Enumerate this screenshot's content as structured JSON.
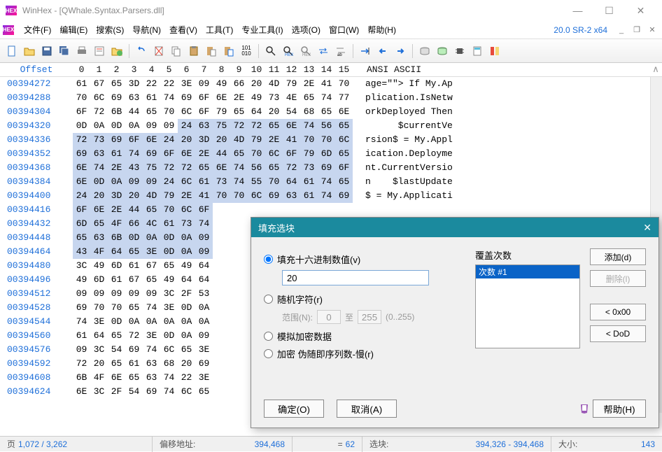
{
  "window": {
    "title": "WinHex - [QWhale.Syntax.Parsers.dll]"
  },
  "menus": [
    "文件(F)",
    "编辑(E)",
    "搜索(S)",
    "导航(N)",
    "查看(V)",
    "工具(T)",
    "专业工具(I)",
    "选项(O)",
    "窗口(W)",
    "帮助(H)"
  ],
  "version": "20.0 SR-2 x64",
  "hex": {
    "offset_label": "Offset",
    "cols": [
      "0",
      "1",
      "2",
      "3",
      "4",
      "5",
      "6",
      "7",
      "8",
      "9",
      "10",
      "11",
      "12",
      "13",
      "14",
      "15"
    ],
    "ansi_label": "ANSI ASCII",
    "rows": [
      {
        "off": "00394272",
        "b": [
          "61",
          "67",
          "65",
          "3D",
          "22",
          "22",
          "3E",
          "09",
          "49",
          "66",
          "20",
          "4D",
          "79",
          "2E",
          "41",
          "70"
        ],
        "t": "age=\"\"> If My.Ap",
        "sel": []
      },
      {
        "off": "00394288",
        "b": [
          "70",
          "6C",
          "69",
          "63",
          "61",
          "74",
          "69",
          "6F",
          "6E",
          "2E",
          "49",
          "73",
          "4E",
          "65",
          "74",
          "77"
        ],
        "t": "plication.IsNetw",
        "sel": []
      },
      {
        "off": "00394304",
        "b": [
          "6F",
          "72",
          "6B",
          "44",
          "65",
          "70",
          "6C",
          "6F",
          "79",
          "65",
          "64",
          "20",
          "54",
          "68",
          "65",
          "6E"
        ],
        "t": "orkDeployed Then",
        "sel": []
      },
      {
        "off": "00394320",
        "b": [
          "0D",
          "0A",
          "0D",
          "0A",
          "09",
          "09",
          "24",
          "63",
          "75",
          "72",
          "72",
          "65",
          "6E",
          "74",
          "56",
          "65"
        ],
        "t": "      $currentVe",
        "sel": [
          6,
          7,
          8,
          9,
          10,
          11,
          12,
          13,
          14,
          15
        ]
      },
      {
        "off": "00394336",
        "b": [
          "72",
          "73",
          "69",
          "6F",
          "6E",
          "24",
          "20",
          "3D",
          "20",
          "4D",
          "79",
          "2E",
          "41",
          "70",
          "70",
          "6C"
        ],
        "t": "rsion$ = My.Appl",
        "sel": [
          0,
          1,
          2,
          3,
          4,
          5,
          6,
          7,
          8,
          9,
          10,
          11,
          12,
          13,
          14,
          15
        ]
      },
      {
        "off": "00394352",
        "b": [
          "69",
          "63",
          "61",
          "74",
          "69",
          "6F",
          "6E",
          "2E",
          "44",
          "65",
          "70",
          "6C",
          "6F",
          "79",
          "6D",
          "65"
        ],
        "t": "ication.Deployme",
        "sel": [
          0,
          1,
          2,
          3,
          4,
          5,
          6,
          7,
          8,
          9,
          10,
          11,
          12,
          13,
          14,
          15
        ]
      },
      {
        "off": "00394368",
        "b": [
          "6E",
          "74",
          "2E",
          "43",
          "75",
          "72",
          "72",
          "65",
          "6E",
          "74",
          "56",
          "65",
          "72",
          "73",
          "69",
          "6F"
        ],
        "t": "nt.CurrentVersio",
        "sel": [
          0,
          1,
          2,
          3,
          4,
          5,
          6,
          7,
          8,
          9,
          10,
          11,
          12,
          13,
          14,
          15
        ]
      },
      {
        "off": "00394384",
        "b": [
          "6E",
          "0D",
          "0A",
          "09",
          "09",
          "24",
          "6C",
          "61",
          "73",
          "74",
          "55",
          "70",
          "64",
          "61",
          "74",
          "65"
        ],
        "t": "n    $lastUpdate",
        "sel": [
          0,
          1,
          2,
          3,
          4,
          5,
          6,
          7,
          8,
          9,
          10,
          11,
          12,
          13,
          14,
          15
        ]
      },
      {
        "off": "00394400",
        "b": [
          "24",
          "20",
          "3D",
          "20",
          "4D",
          "79",
          "2E",
          "41",
          "70",
          "70",
          "6C",
          "69",
          "63",
          "61",
          "74",
          "69"
        ],
        "t": "$ = My.Applicati",
        "sel": [
          0,
          1,
          2,
          3,
          4,
          5,
          6,
          7,
          8,
          9,
          10,
          11,
          12,
          13,
          14,
          15
        ]
      },
      {
        "off": "00394416",
        "b": [
          "6F",
          "6E",
          "2E",
          "44",
          "65",
          "70",
          "6C",
          "6F",
          "",
          "",
          "",
          "",
          "",
          "",
          "",
          ""
        ],
        "t": "",
        "sel": [
          0,
          1,
          2,
          3,
          4,
          5,
          6,
          7
        ]
      },
      {
        "off": "00394432",
        "b": [
          "6D",
          "65",
          "4F",
          "66",
          "4C",
          "61",
          "73",
          "74",
          "",
          "",
          "",
          "",
          "",
          "",
          "",
          ""
        ],
        "t": "",
        "sel": [
          0,
          1,
          2,
          3,
          4,
          5,
          6,
          7
        ]
      },
      {
        "off": "00394448",
        "b": [
          "65",
          "63",
          "6B",
          "0D",
          "0A",
          "0D",
          "0A",
          "09",
          "",
          "",
          "",
          "",
          "",
          "",
          "",
          ""
        ],
        "t": "",
        "sel": [
          0,
          1,
          2,
          3,
          4,
          5,
          6,
          7
        ]
      },
      {
        "off": "00394464",
        "b": [
          "43",
          "4F",
          "64",
          "65",
          "3E",
          "0D",
          "0A",
          "09",
          "",
          "",
          "",
          "",
          "",
          "",
          "",
          ""
        ],
        "t": "",
        "sel": [
          0,
          1,
          2,
          3,
          4,
          5,
          6,
          7
        ]
      },
      {
        "off": "00394480",
        "b": [
          "3C",
          "49",
          "6D",
          "61",
          "67",
          "65",
          "49",
          "64",
          "",
          "",
          "",
          "",
          "",
          "",
          "",
          ""
        ],
        "t": "",
        "sel": []
      },
      {
        "off": "00394496",
        "b": [
          "49",
          "6D",
          "61",
          "67",
          "65",
          "49",
          "64",
          "64",
          "",
          "",
          "",
          "",
          "",
          "",
          "",
          ""
        ],
        "t": "",
        "sel": []
      },
      {
        "off": "00394512",
        "b": [
          "09",
          "09",
          "09",
          "09",
          "09",
          "3C",
          "2F",
          "53",
          "",
          "",
          "",
          "",
          "",
          "",
          "",
          ""
        ],
        "t": "",
        "sel": []
      },
      {
        "off": "00394528",
        "b": [
          "69",
          "70",
          "70",
          "65",
          "74",
          "3E",
          "0D",
          "0A",
          "",
          "",
          "",
          "",
          "",
          "",
          "",
          ""
        ],
        "t": "",
        "sel": []
      },
      {
        "off": "00394544",
        "b": [
          "74",
          "3E",
          "0D",
          "0A",
          "0A",
          "0A",
          "0A",
          "0A",
          "",
          "",
          "",
          "",
          "",
          "",
          "",
          ""
        ],
        "t": "",
        "sel": []
      },
      {
        "off": "00394560",
        "b": [
          "61",
          "64",
          "65",
          "72",
          "3E",
          "0D",
          "0A",
          "09",
          "",
          "",
          "",
          "",
          "",
          "",
          "",
          ""
        ],
        "t": "",
        "sel": []
      },
      {
        "off": "00394576",
        "b": [
          "09",
          "3C",
          "54",
          "69",
          "74",
          "6C",
          "65",
          "3E",
          "",
          "",
          "",
          "",
          "",
          "",
          "",
          ""
        ],
        "t": "",
        "sel": []
      },
      {
        "off": "00394592",
        "b": [
          "72",
          "20",
          "65",
          "61",
          "63",
          "68",
          "20",
          "69",
          "",
          "",
          "",
          "",
          "",
          "",
          "",
          ""
        ],
        "t": "",
        "sel": []
      },
      {
        "off": "00394608",
        "b": [
          "6B",
          "4F",
          "6E",
          "65",
          "63",
          "74",
          "22",
          "3E",
          "",
          "",
          "",
          "",
          "",
          "",
          "",
          ""
        ],
        "t": "",
        "sel": []
      },
      {
        "off": "00394624",
        "b": [
          "6E",
          "3C",
          "2F",
          "54",
          "69",
          "74",
          "6C",
          "65",
          "",
          "",
          "",
          "",
          "",
          "",
          "",
          ""
        ],
        "t": "",
        "sel": []
      }
    ]
  },
  "status": {
    "page_label": "页",
    "page_val": "1,072 / 3,262",
    "offset_label": "偏移地址:",
    "offset_val": "394,468",
    "eq_label": "=",
    "eq_val": "62",
    "sel_label": "选块:",
    "sel_val": "394,326 - 394,468",
    "size_label": "大小:",
    "size_val": "143"
  },
  "dialog": {
    "title": "填充选块",
    "opt_hex": "填充十六进制数值(v)",
    "hex_value": "20",
    "opt_rand": "随机字符(r)",
    "range_label": "范围(N):",
    "range_from": "0",
    "range_to_label": "至",
    "range_to": "255",
    "range_hint": "(0..255)",
    "opt_sim": "模拟加密数据",
    "opt_enc": "加密 伪随即序列数-慢(r)",
    "passes_label": "覆盖次数",
    "pass_item": "次数 #1",
    "btn_add": "添加(d)",
    "btn_del": "删除(l)",
    "btn_0x00": "< 0x00",
    "btn_dod": "< DoD",
    "btn_ok": "确定(O)",
    "btn_cancel": "取消(A)",
    "btn_help": "帮助(H)"
  }
}
